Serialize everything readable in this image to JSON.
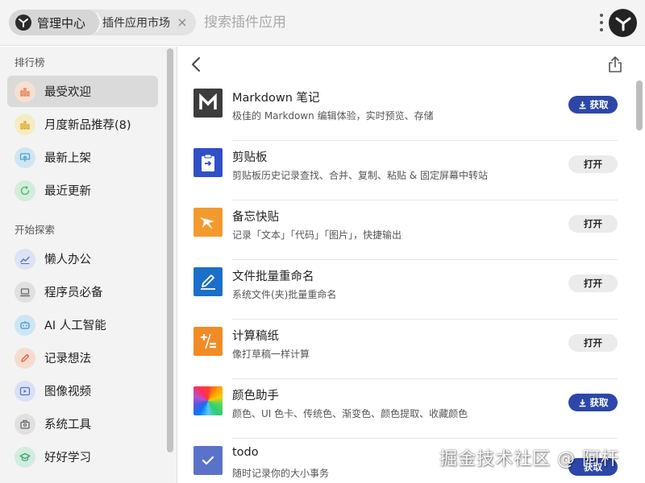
{
  "header": {
    "home_label": "管理中心",
    "app_tab_label": "插件应用市场",
    "close_glyph": "×",
    "search_placeholder": "搜索插件应用"
  },
  "sidebar": {
    "ranking_title": "排行榜",
    "ranking_items": [
      {
        "label": "最受欢迎",
        "icon": "bar-chart-icon",
        "color": "#e5784a",
        "bg": "#f8dfd2"
      },
      {
        "label": "月度新品推荐(8)",
        "icon": "bar-chart-icon",
        "color": "#d9a51e",
        "bg": "#f7ebc4"
      },
      {
        "label": "最新上架",
        "icon": "upload-icon",
        "color": "#4fa0c8",
        "bg": "#cfe6f2"
      },
      {
        "label": "最近更新",
        "icon": "refresh-icon",
        "color": "#52b66f",
        "bg": "#d2eedb"
      }
    ],
    "explore_title": "开始探索",
    "explore_items": [
      {
        "label": "懒人办公",
        "icon": "chart-trend-icon",
        "color": "#5a6fc0",
        "bg": "#dde2f4"
      },
      {
        "label": "程序员必备",
        "icon": "laptop-icon",
        "color": "#666666",
        "bg": "#e0e0e0"
      },
      {
        "label": "AI 人工智能",
        "icon": "robot-icon",
        "color": "#3e97c7",
        "bg": "#cde6f3"
      },
      {
        "label": "记录想法",
        "icon": "pencil-icon",
        "color": "#d9673a",
        "bg": "#f6dccf"
      },
      {
        "label": "图像视频",
        "icon": "video-icon",
        "color": "#5574c4",
        "bg": "#d9e1f4"
      },
      {
        "label": "系统工具",
        "icon": "toolbox-icon",
        "color": "#666666",
        "bg": "#e0e0e0"
      },
      {
        "label": "好好学习",
        "icon": "graduation-cap-icon",
        "color": "#3fa36b",
        "bg": "#d2ede0"
      }
    ]
  },
  "main": {
    "get_label": "获取",
    "open_label": "打开",
    "apps": [
      {
        "name": "Markdown 笔记",
        "desc": "极佳的 Markdown 编辑体验，实时预览、存储",
        "action": "get",
        "icon": "markdown-icon",
        "icon_bg": "#3c3c3c"
      },
      {
        "name": "剪贴板",
        "desc": "剪贴板历史记录查找、合并、复制、粘贴 & 固定屏幕中转站",
        "action": "open",
        "icon": "clipboard-icon",
        "icon_bg": "#2f4fc7"
      },
      {
        "name": "备忘快贴",
        "desc": "记录「文本」「代码」「图片」，快捷输出",
        "action": "open",
        "icon": "star-note-icon",
        "icon_bg": "#f39a2e"
      },
      {
        "name": "文件批量重命名",
        "desc": "系统文件(夹)批量重命名",
        "action": "open",
        "icon": "rename-pen-icon",
        "icon_bg": "#1b6fc9"
      },
      {
        "name": "计算稿纸",
        "desc": "像打草稿一样计算",
        "action": "open",
        "icon": "calculator-icon",
        "icon_bg": "#f28b26"
      },
      {
        "name": "颜色助手",
        "desc": "颜色、UI 色卡、传统色、渐变色、颜色提取、收藏颜色",
        "action": "get",
        "icon": "color-wheel-icon",
        "icon_bg": "#e64545"
      },
      {
        "name": "todo",
        "desc": "随时记录你的大小事务",
        "action": "get",
        "icon": "checkbox-icon",
        "icon_bg": "#5a72c8"
      }
    ]
  },
  "watermark": "掘金技术社区 @ 阿杆"
}
